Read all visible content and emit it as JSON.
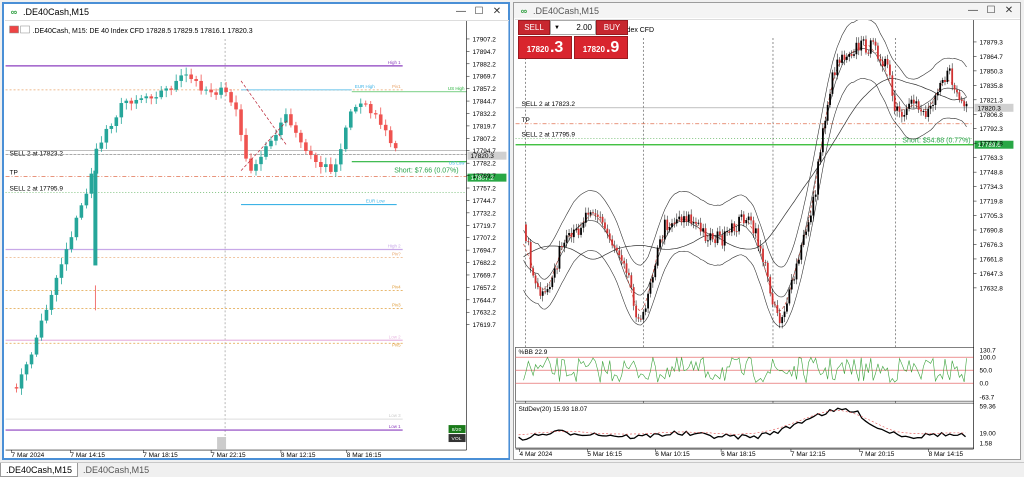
{
  "left": {
    "title": ".DE40Cash,M15",
    "info": ".DE40Cash, M15:  DE 40 Index CFD  17828.5 17829.5 17816.1 17820.3",
    "price_labels": [
      "17907.2",
      "17894.7",
      "17882.2",
      "17869.7",
      "17857.2",
      "17844.7",
      "17832.2",
      "17819.7",
      "17807.2",
      "17794.7",
      "17782.2",
      "17769.7",
      "17757.2",
      "17744.7",
      "17732.2",
      "17719.7",
      "17707.2",
      "17694.7",
      "17682.2",
      "17669.7",
      "17657.2",
      "17644.7",
      "17632.2",
      "17619.7"
    ],
    "time_labels": [
      "7 Mar 2024",
      "7 Mar 14:15",
      "7 Mar 18:15",
      "7 Mar 22:15",
      "8 Mar 12:15",
      "8 Mar 16:15"
    ],
    "levels": {
      "sell2_a": "SELL 2 at 17823.2",
      "tp": "TP",
      "sell2_b": "SELL 2 at 17795.9",
      "high1": "High 1",
      "eur_high": "EUR High",
      "us_high": "US High",
      "piv1": "Piv1",
      "us_low": "US Low",
      "eur_low": "EUR Low",
      "high2": "High 2",
      "piv_mid": "Piv?",
      "piv4": "Piv4",
      "piv3": "Piv3",
      "low2": "Low 2",
      "piv_low": "Piv5",
      "low3": "Low 3",
      "low1": "Low 1"
    },
    "current_price_tag": "17820.3",
    "tp_price_tag": "17807.2",
    "short_label": "Short:  $7.66 (0.07%)",
    "vol_tags": [
      "8/20",
      "VOL"
    ],
    "sep_label": "0.00"
  },
  "right": {
    "title": ".DE40Cash,M15",
    "info": ".DE40Cash, M15:  DE 40 Index CFD",
    "trade": {
      "sell_label": "SELL",
      "buy_label": "BUY",
      "volume": "2.00",
      "sell_small": "17820",
      "sell_big": ".3",
      "buy_small": "17820",
      "buy_big": ".9"
    },
    "price_labels": [
      "17879.3",
      "17864.7",
      "17850.3",
      "17835.8",
      "17821.3",
      "17806.8",
      "17792.3",
      "17777.8",
      "17763.3",
      "17748.8",
      "17734.3",
      "17719.8",
      "17705.3",
      "17690.8",
      "17676.3",
      "17661.8",
      "17647.3",
      "17632.8"
    ],
    "levels": {
      "sell2_a": "SELL 2 at 17823.2",
      "tp": "TP",
      "sell2_b": "SELL 2 at 17795.9"
    },
    "current_price_tag": "17820.3",
    "green_tag": "17789.6",
    "short_label": "Short:  $54.88 (0.77%)",
    "bb_label": "%BB 22.9",
    "bb_scale": [
      "130.7",
      "100.0",
      "50.0",
      "0.0",
      "-63.7"
    ],
    "std_label": "StdDev(20) 15.93 18.07",
    "std_scale": [
      "59.36",
      "19.00",
      "1.58"
    ],
    "time_labels": [
      "4 Mar 2024",
      "5 Mar 16:15",
      "6 Mar 10:15",
      "6 Mar 18:15",
      "7 Mar 12:15",
      "7 Mar 20:15",
      "8 Mar 14:15"
    ]
  },
  "tabs": [
    ".DE40Cash,M15",
    ".DE40Cash,M15"
  ],
  "colors": {
    "bull": "#26a69a",
    "bear": "#ef5350",
    "sell": "#d9252e",
    "ma": "#c0392b"
  }
}
